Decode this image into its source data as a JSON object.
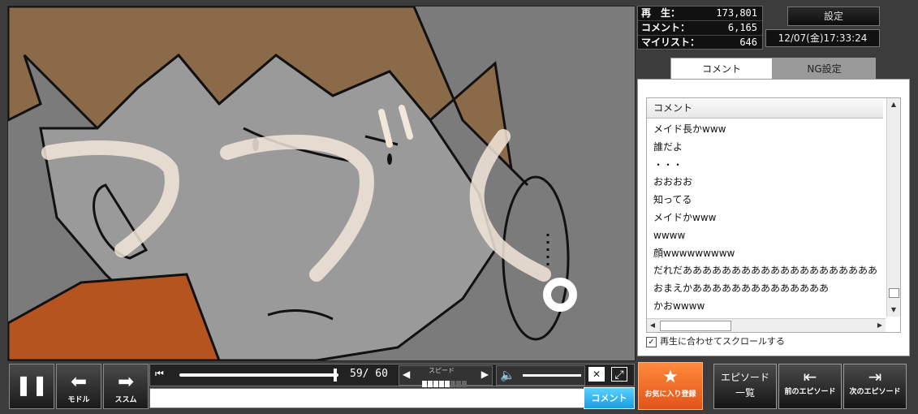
{
  "stats": {
    "plays_label": "再　生：",
    "plays_value": "173,801",
    "comments_label": "コメント：",
    "comments_value": "6,165",
    "mylist_label": "マイリスト：",
    "mylist_value": "646"
  },
  "settings_label": "設定",
  "datetime": "12/07(金)17:33:24",
  "tabs": [
    {
      "label": "コメント",
      "active": true
    },
    {
      "label": "NG設定",
      "active": false
    }
  ],
  "comment_list": {
    "header": "コメント",
    "rows": [
      "メイド長かwww",
      "誰だよ",
      "・・・",
      "おおおお",
      "知ってる",
      "メイドかwww",
      "wwww",
      "顔wwwwwwwww",
      "だれだああああああああああああああああああああ",
      "おまえかああああああああああああああ",
      "かおwwww"
    ]
  },
  "autoscroll_label": "再生に合わせてスクロールする",
  "autoscroll_checked": true,
  "controls": {
    "pause_icon": "pause-icon",
    "back_label": "モドル",
    "forward_label": "ススム",
    "time_display": "59/ 60",
    "speed_label": "スピード",
    "progress": 0.98,
    "comment_submit_label": "コメント",
    "favorite_label": "お気に入り登録",
    "episode_list_label_line1": "エピソード",
    "episode_list_label_line2": "一覧",
    "prev_episode_label": "前のエピソード",
    "next_episode_label": "次のエピソード"
  },
  "colors": {
    "favorite_orange": "#e2541a",
    "comment_submit_blue": "#1a9de0",
    "video_bg": "#7b7b7b"
  },
  "video_overlay_text": "つづく"
}
